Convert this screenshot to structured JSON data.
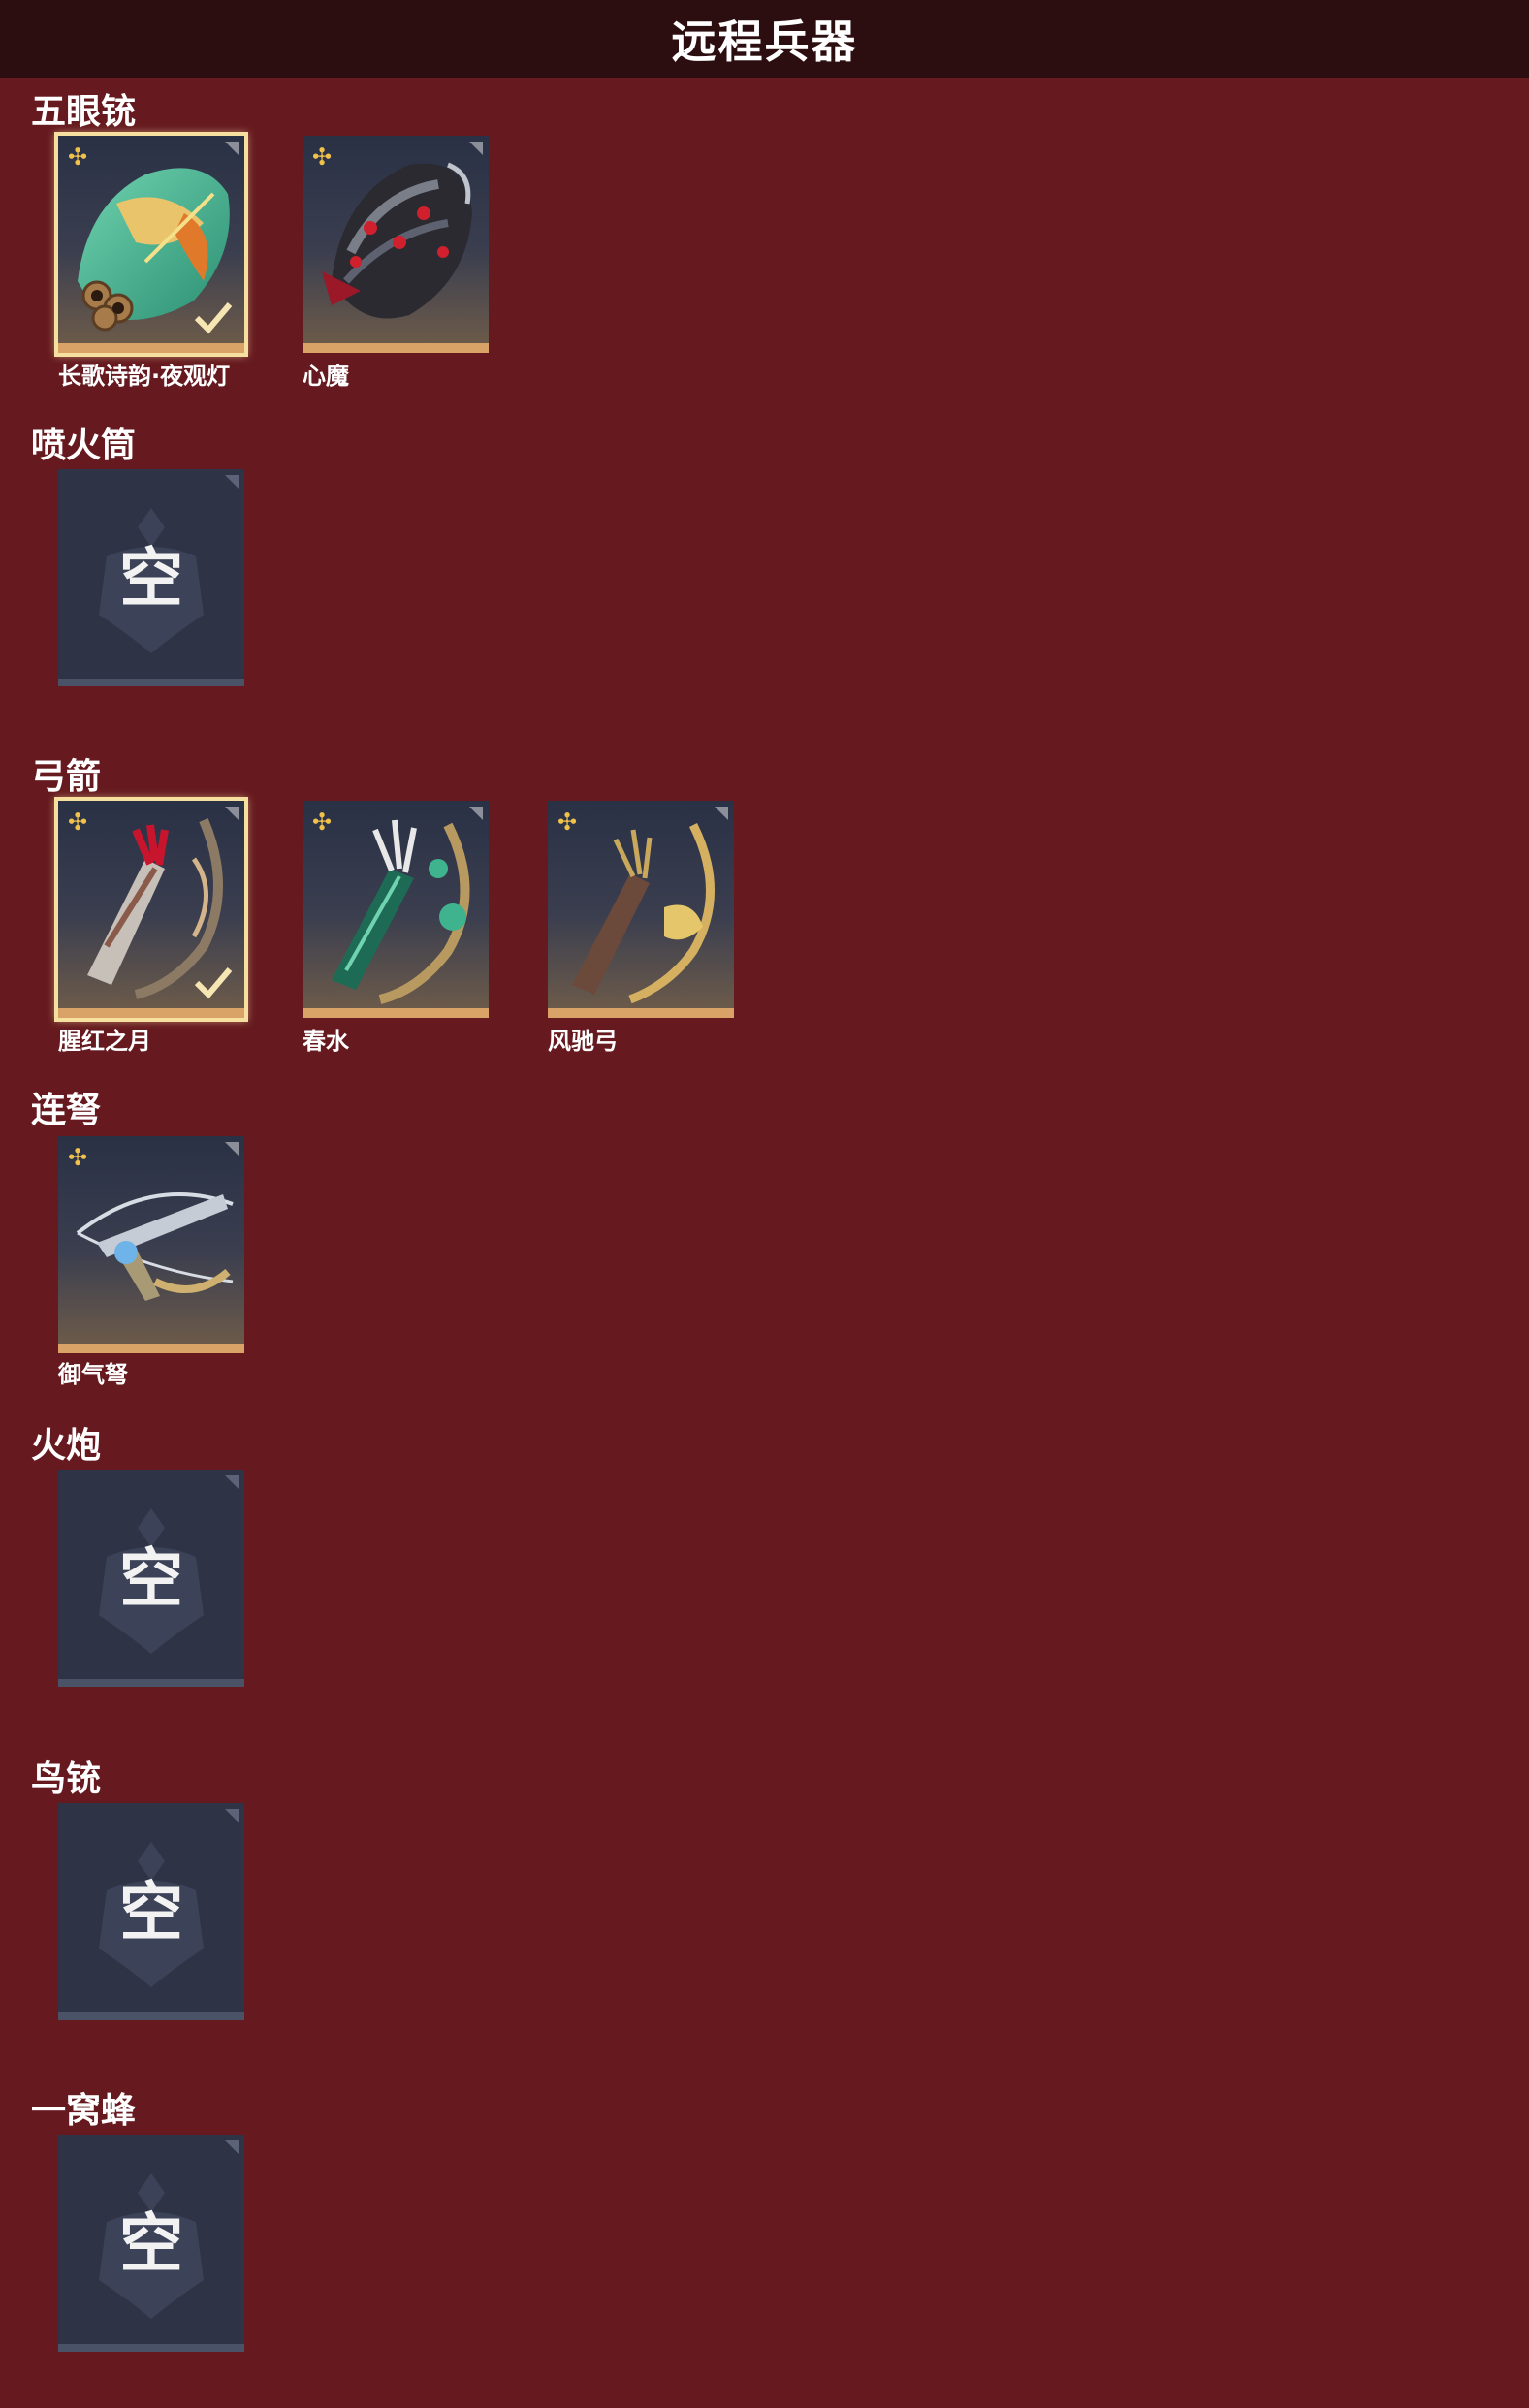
{
  "header": {
    "title": "远程兵器"
  },
  "empty_label": "空",
  "colors": {
    "background": "#661a1f",
    "header_bg": "#2d0e10",
    "card_accent": "#d9a266",
    "selected_border": "#f6e0a0",
    "star": "#f0c14b"
  },
  "sections": [
    {
      "title": "五眼铳",
      "items": [
        {
          "name": "长歌诗韵·夜观灯",
          "selected": true,
          "icon": "multi-barrel-gun-icon"
        },
        {
          "name": "心魔",
          "selected": false,
          "icon": "dark-gun-icon"
        }
      ]
    },
    {
      "title": "喷火筒",
      "items": []
    },
    {
      "title": "弓箭",
      "items": [
        {
          "name": "腥红之月",
          "selected": true,
          "icon": "red-bow-icon"
        },
        {
          "name": "春水",
          "selected": false,
          "icon": "jade-bow-icon"
        },
        {
          "name": "风驰弓",
          "selected": false,
          "icon": "gold-bow-icon"
        }
      ]
    },
    {
      "title": "连弩",
      "items": [
        {
          "name": "御气弩",
          "selected": false,
          "icon": "crossbow-icon"
        }
      ]
    },
    {
      "title": "火炮",
      "items": []
    },
    {
      "title": "鸟铳",
      "items": []
    },
    {
      "title": "一窝蜂",
      "items": []
    }
  ]
}
